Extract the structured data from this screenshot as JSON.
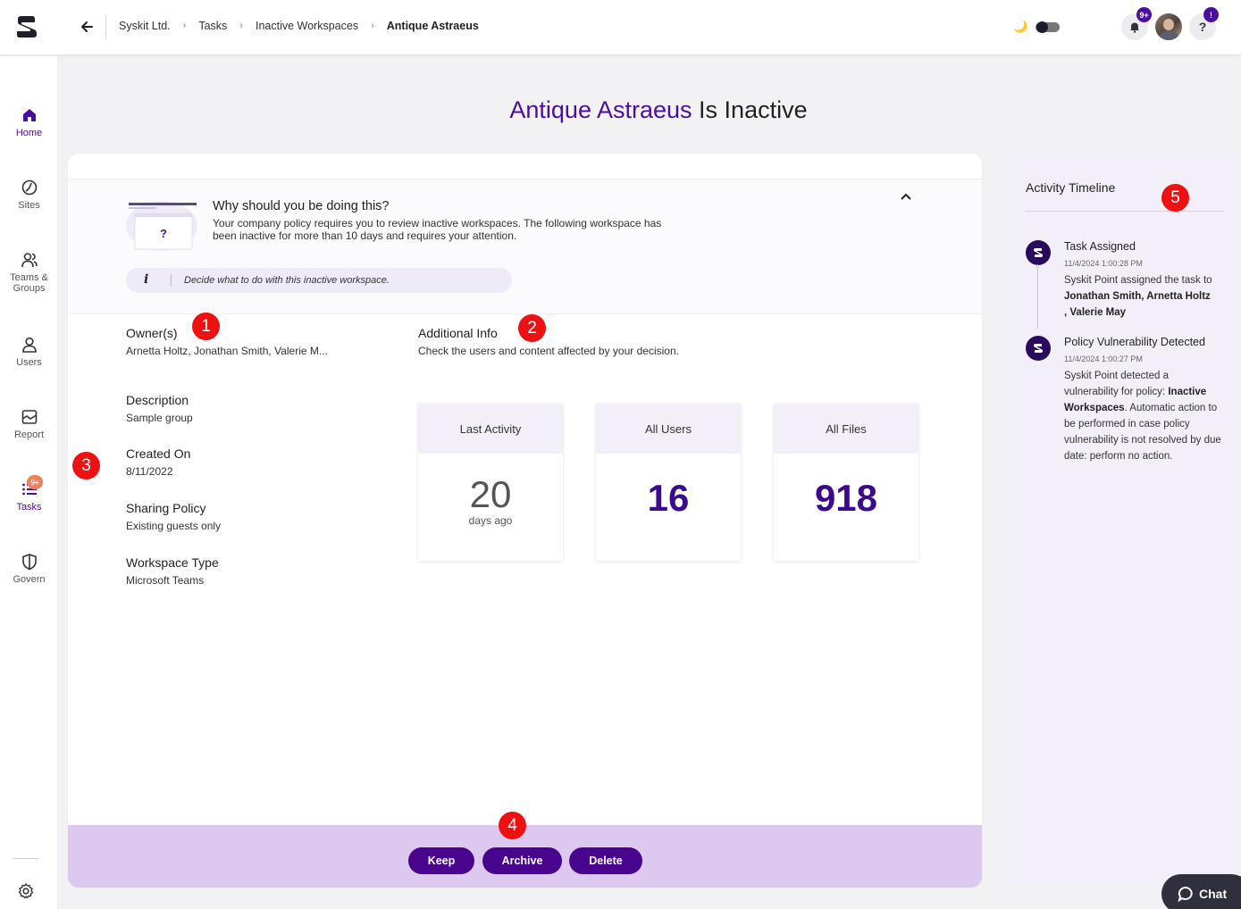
{
  "header": {
    "breadcrumb": [
      "Syskit Ltd.",
      "Tasks",
      "Inactive Workspaces"
    ],
    "breadcrumb_current": "Antique Astraeus",
    "notifications_badge": "9+",
    "help_badge": "!"
  },
  "sidebar": {
    "items": [
      {
        "label": "Home"
      },
      {
        "label": "Sites"
      },
      {
        "label": "Teams &"
      },
      {
        "label": "Groups"
      },
      {
        "label": "Users"
      },
      {
        "label": "Report"
      },
      {
        "label": "Tasks",
        "badge": "9+"
      },
      {
        "label": "Govern"
      }
    ]
  },
  "title": {
    "workspace": "Antique Astraeus",
    "suffix": "Is Inactive"
  },
  "why": {
    "title": "Why should you be doing this?",
    "text": "Your company policy requires you to review inactive workspaces. The following workspace has been inactive for more than 10 days and requires your attention.",
    "hint": "Decide what to do with this inactive workspace.",
    "hint_icon": "i",
    "illustration_mark": "?"
  },
  "details": {
    "owners_label": "Owner(s)",
    "owners_value": "Arnetta Holtz, Jonathan Smith, Valerie M...",
    "description_label": "Description",
    "description_value": "Sample group",
    "created_label": "Created On",
    "created_value": "8/11/2022",
    "sharing_label": "Sharing Policy",
    "sharing_value": "Existing guests only",
    "type_label": "Workspace Type",
    "type_value": "Microsoft Teams"
  },
  "additional": {
    "label": "Additional Info",
    "text": "Check the users and content affected by your decision."
  },
  "stats": [
    {
      "label": "Last Activity",
      "value": "20",
      "sub": "days ago"
    },
    {
      "label": "All Users",
      "value": "16"
    },
    {
      "label": "All Files",
      "value": "918"
    }
  ],
  "actions": {
    "keep": "Keep",
    "archive": "Archive",
    "delete": "Delete"
  },
  "timeline": {
    "title": "Activity Timeline",
    "events": [
      {
        "title": "Task Assigned",
        "time": "11/4/2024 1:00:28 PM",
        "text_pre": "Syskit Point assigned the task to",
        "names": "Jonathan Smith,  Arnetta Holtz",
        "names2": ",  Valerie May"
      },
      {
        "title": "Policy Vulnerability Detected",
        "time": "11/4/2024 1:00:27 PM",
        "text_pre": "Syskit Point detected a vulnerability for policy:",
        "policy": "Inactive Workspaces",
        "text_post": ". Automatic action to be performed in case policy vulnerability is not resolved by due date: perform no action."
      }
    ]
  },
  "chat_label": "Chat",
  "markers": [
    "1",
    "2",
    "3",
    "4",
    "5"
  ],
  "colors": {
    "brand": "#4b0fa0",
    "marker": "#ee1111",
    "footer": "#ddc9ef",
    "button": "#48068f"
  }
}
